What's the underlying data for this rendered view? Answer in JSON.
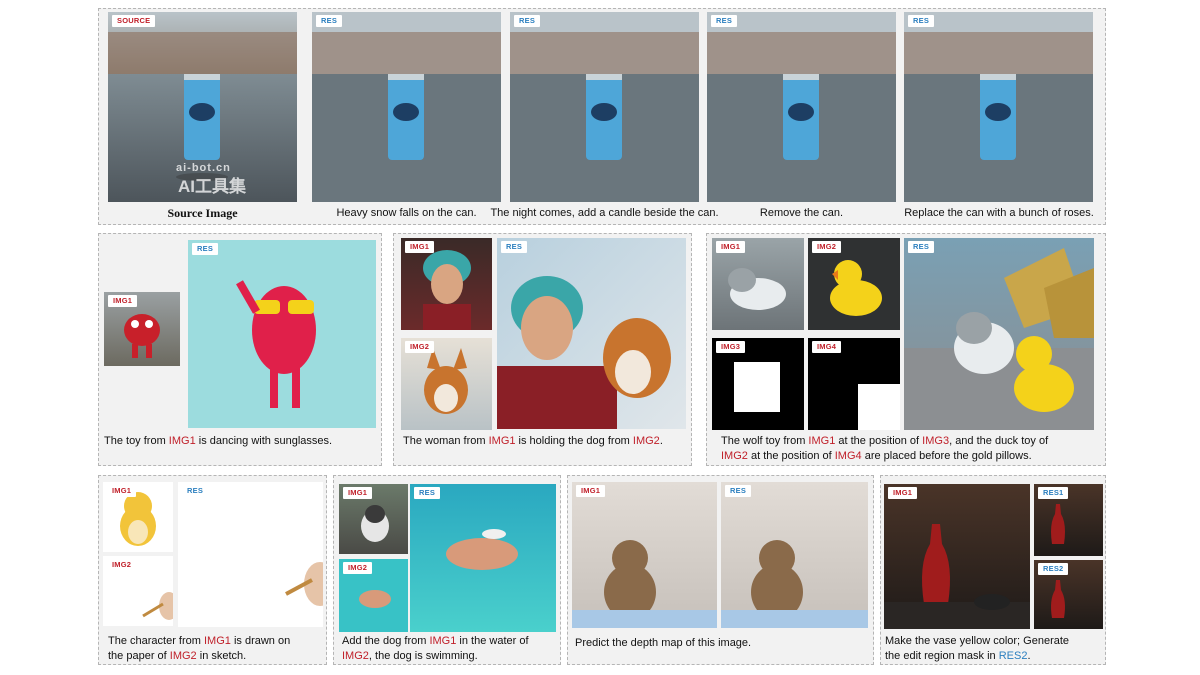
{
  "row1": {
    "tags": {
      "source": "SOURCE",
      "res": "RES"
    },
    "captions": {
      "source": "Source Image",
      "res1": "Heavy snow falls on the can.",
      "res2": "The night comes, add a candle beside the can.",
      "res3": "Remove the can.",
      "res4": "Replace the can with a bunch of roses."
    },
    "watermark": {
      "line1": "ai-bot.cn",
      "line2": "AI工具集"
    }
  },
  "row2": {
    "p1": {
      "tag_img1": "IMG1",
      "tag_res": "RES",
      "caption": {
        "a": "The toy from ",
        "b": "IMG1",
        "c": " is dancing with sunglasses."
      }
    },
    "p2": {
      "tag_img1": "IMG1",
      "tag_img2": "IMG2",
      "tag_res": "RES",
      "caption": {
        "a": "The woman from ",
        "b": "IMG1",
        "c": " is holding the dog from ",
        "d": "IMG2",
        "e": "."
      }
    },
    "p3": {
      "tag_img1": "IMG1",
      "tag_img2": "IMG2",
      "tag_img3": "IMG3",
      "tag_img4": "IMG4",
      "tag_res": "RES",
      "caption": {
        "a": "The wolf toy from ",
        "b": "IMG1",
        "c": " at the position of ",
        "d": "IMG3",
        "e": ", and the duck toy of",
        "f": "IMG2",
        "g": " at the position of ",
        "h": "IMG4",
        "i": " are placed before the gold pillows."
      }
    }
  },
  "row3": {
    "p1": {
      "tag_img1": "IMG1",
      "tag_img2": "IMG2",
      "tag_res": "RES",
      "caption": {
        "a": "The character from ",
        "b": "IMG1",
        "c": " is drawn on",
        "d": "the paper of ",
        "e": "IMG2",
        "f": " in sketch."
      }
    },
    "p2": {
      "tag_img1": "IMG1",
      "tag_img2": "IMG2",
      "tag_res": "RES",
      "caption": {
        "a": "Add the dog from ",
        "b": "IMG1",
        "c": " in the water of",
        "d": "IMG2",
        "e": ", the dog is swimming."
      }
    },
    "p3": {
      "tag_img1": "IMG1",
      "tag_res": "RES",
      "caption": "Predict the depth map of this image."
    },
    "p4": {
      "tag_img1": "IMG1",
      "tag_res1": "RES1",
      "tag_res2": "RES2",
      "caption": {
        "a": "Make the vase yellow color; Generate",
        "b": "the edit region mask in ",
        "c": "RES2",
        "d": "."
      }
    }
  }
}
